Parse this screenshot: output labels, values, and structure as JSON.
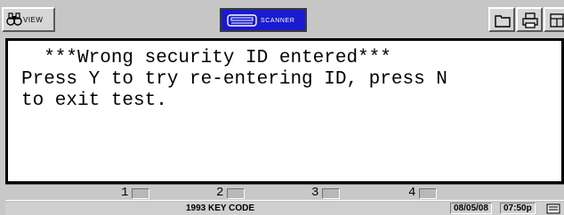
{
  "toolbar": {
    "view_label": "VIEW",
    "scanner_label": "SCANNER",
    "icons": [
      "binoculars-icon",
      "scanner-icon",
      "folder-icon",
      "printer-icon",
      "help-icon"
    ]
  },
  "screen": {
    "line1": "  ***Wrong security ID entered***",
    "line2": "Press Y to try re-entering ID, press N",
    "line3": "to exit test."
  },
  "fkeys": [
    {
      "label": "1"
    },
    {
      "label": "2"
    },
    {
      "label": "3"
    },
    {
      "label": "4"
    }
  ],
  "status": {
    "title": "1993 KEY CODE",
    "date": "08/05/08",
    "time": "07:50p"
  },
  "colors": {
    "scanner_blue": "#1a1ad0",
    "toolbar_gray": "#c6c6c6"
  }
}
